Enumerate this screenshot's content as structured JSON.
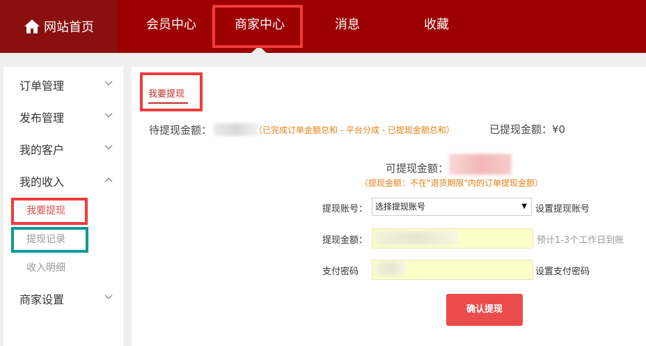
{
  "nav": {
    "home_label": "网站首页",
    "items": [
      "会员中心",
      "商家中心",
      "消息",
      "收藏"
    ]
  },
  "sidebar": {
    "menus": [
      "订单管理",
      "发布管理",
      "我的客户",
      "我的收入",
      "商家设置"
    ],
    "income_submenu": [
      "我要提现",
      "提现记录",
      "收入明细"
    ]
  },
  "main": {
    "tab": "我要提现",
    "pending_label": "待提现金额：",
    "pending_note": "（已完成订单金额总和 - 平台分成 - 已提现金额总和）",
    "withdrawn_label": "已提现金额：¥0",
    "available_label": "可提现金额：",
    "available_note": "（提现金额：不在\"退货期限\"内的订单提现金额）",
    "form": {
      "account_label": "提现账号：",
      "account_select": "选择提现账号",
      "account_link": "设置提现账号",
      "amount_label": "提现金额：",
      "amount_hint": "预计1-3个工作日到账",
      "password_label": "支付密码",
      "password_link": "设置支付密码",
      "submit": "确认提现"
    }
  },
  "colors": {
    "nav_bg": "#9d0000",
    "accent": "#c52b2b",
    "note_orange": "#e87f16",
    "button": "#ea4c4c",
    "input_bg": "#fbffc7"
  }
}
